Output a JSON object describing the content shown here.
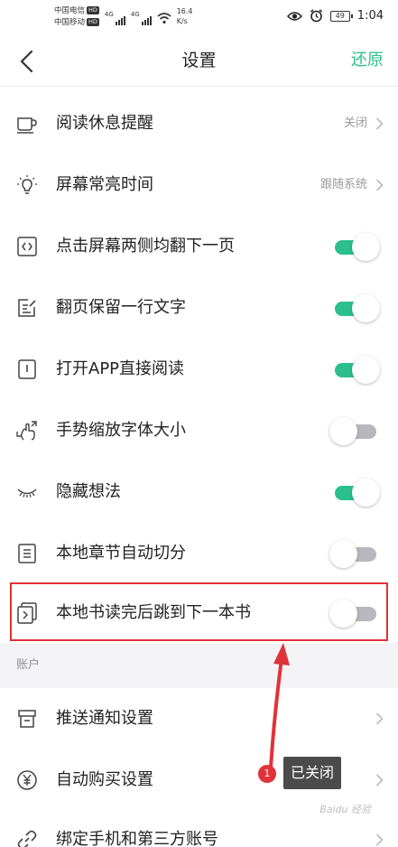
{
  "status_bar": {
    "carrier_1": "中国电信",
    "carrier_2": "中国移动",
    "hd": "HD",
    "net": "4G",
    "speed_value": "16.4",
    "speed_unit": "K/s",
    "battery": "49",
    "time": "1:04"
  },
  "header": {
    "title": "设置",
    "restore_label": "还原"
  },
  "settings": [
    {
      "label": "阅读休息提醒",
      "value": "关闭",
      "icon": "cup-icon"
    },
    {
      "label": "屏幕常亮时间",
      "value": "跟随系统",
      "icon": "lightbulb-icon"
    },
    {
      "label": "点击屏幕两侧均翻下一页",
      "toggle": true,
      "icon": "code-brackets-icon"
    },
    {
      "label": "翻页保留一行文字",
      "toggle": true,
      "icon": "edit-note-icon"
    },
    {
      "label": "打开APP直接阅读",
      "toggle": true,
      "icon": "open-book-icon"
    },
    {
      "label": "手势缩放字体大小",
      "toggle": false,
      "icon": "pinch-gesture-icon"
    },
    {
      "label": "隐藏想法",
      "toggle": true,
      "icon": "closed-eye-icon"
    },
    {
      "label": "本地章节自动切分",
      "toggle": false,
      "icon": "list-doc-icon"
    },
    {
      "label": "本地书读完后跳到下一本书",
      "toggle": false,
      "icon": "next-book-icon"
    }
  ],
  "account_section": {
    "title": "账户",
    "items": [
      {
        "label": "推送通知设置",
        "icon": "notification-box-icon"
      },
      {
        "label": "自动购买设置",
        "icon": "yuan-coin-icon"
      },
      {
        "label": "绑定手机和第三方账号",
        "icon": "link-icon"
      }
    ]
  },
  "annotation": {
    "badge_number": "1",
    "tooltip_text": "已关闭",
    "highlight_color": "#e0323a"
  },
  "watermark": "Baidu 经验",
  "colors": {
    "accent": "#2bbf8e",
    "toggle_off": "#b7b7bd"
  }
}
